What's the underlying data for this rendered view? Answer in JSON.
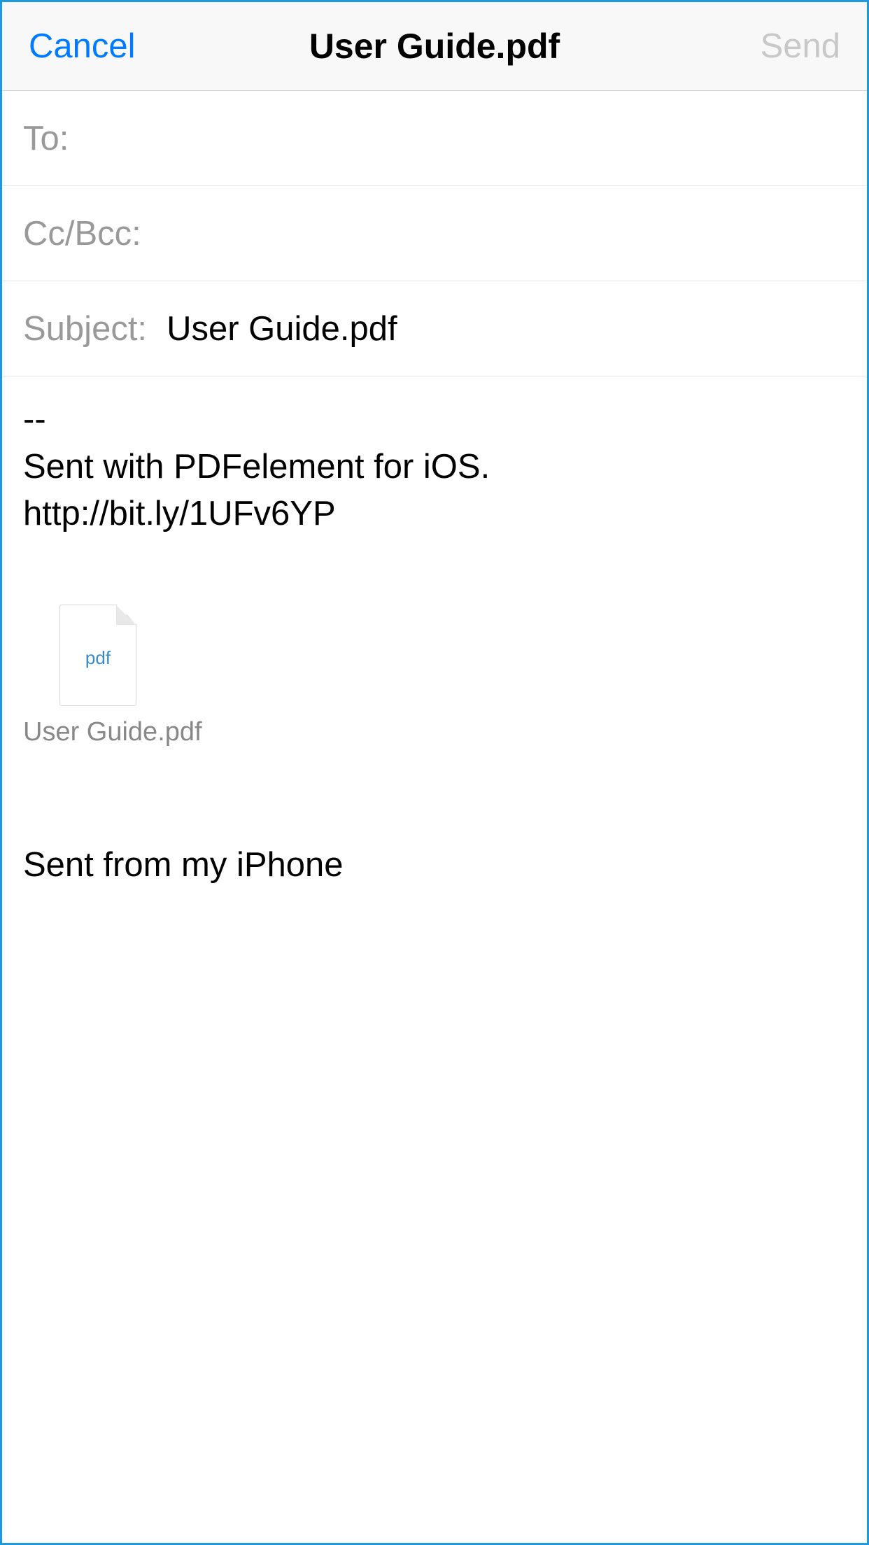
{
  "header": {
    "cancel_label": "Cancel",
    "title": "User Guide.pdf",
    "send_label": "Send"
  },
  "fields": {
    "to_label": "To:",
    "to_value": "",
    "ccbcc_label": "Cc/Bcc:",
    "ccbcc_value": "",
    "subject_label": "Subject:",
    "subject_value": "User Guide.pdf"
  },
  "body": {
    "text": "--\nSent with PDFelement for iOS.\nhttp://bit.ly/1UFv6YP"
  },
  "attachment": {
    "type_badge": "pdf",
    "filename": "User Guide.pdf"
  },
  "signature": {
    "text": "Sent from my iPhone"
  }
}
